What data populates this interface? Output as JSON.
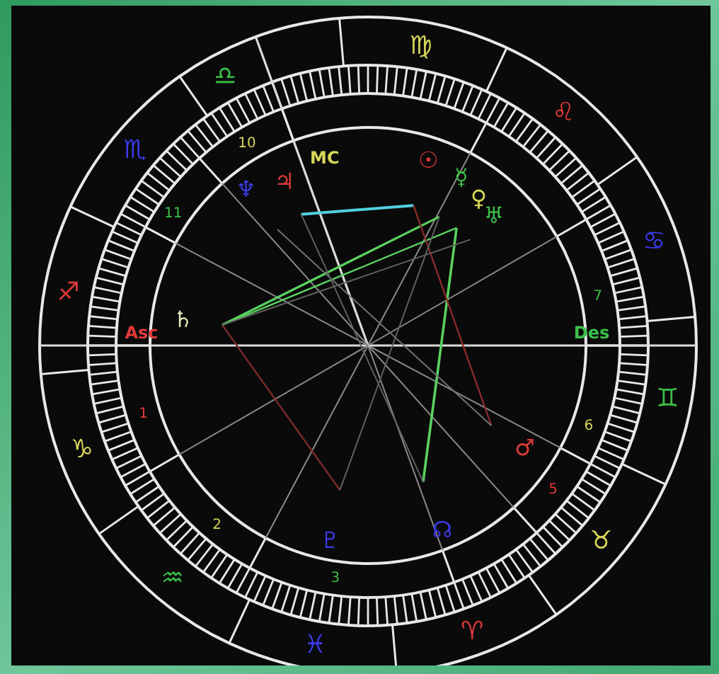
{
  "chart": {
    "signs": [
      {
        "glyph": "♎",
        "color": "#3cc048"
      },
      {
        "glyph": "♍",
        "color": "#d6d65a"
      },
      {
        "glyph": "♌",
        "color": "#e03a3a"
      },
      {
        "glyph": "♋",
        "color": "#3a3ae6"
      },
      {
        "glyph": "♊",
        "color": "#3cc048"
      },
      {
        "glyph": "♉",
        "color": "#d6d65a"
      },
      {
        "glyph": "♈",
        "color": "#e03a3a"
      },
      {
        "glyph": "♓",
        "color": "#3a3ae6"
      },
      {
        "glyph": "♒",
        "color": "#3cc048"
      },
      {
        "glyph": "♑",
        "color": "#d6d65a"
      },
      {
        "glyph": "♐",
        "color": "#e03a3a"
      },
      {
        "glyph": "♏",
        "color": "#3a3ae6"
      }
    ],
    "houses": [
      {
        "number": "1",
        "color": "#e03a3a"
      },
      {
        "number": "2",
        "color": "#d6d65a"
      },
      {
        "number": "3",
        "color": "#3cc048"
      },
      {
        "number": "5",
        "color": "#e03a3a"
      },
      {
        "number": "6",
        "color": "#d6d65a"
      },
      {
        "number": "7",
        "color": "#3cc048"
      },
      {
        "number": "10",
        "color": "#d6d65a"
      },
      {
        "number": "11",
        "color": "#3cc048"
      }
    ],
    "angles": [
      {
        "label": "Asc",
        "color": "#e03a3a"
      },
      {
        "label": "Des",
        "color": "#3cc048"
      },
      {
        "label": "MC",
        "color": "#d6d65a"
      }
    ],
    "planets": [
      {
        "glyph": "♃",
        "color": "#e03a3a"
      },
      {
        "glyph": "♆",
        "color": "#3a3ae6"
      },
      {
        "glyph": "☉",
        "color": "#e03a3a"
      },
      {
        "glyph": "☿",
        "color": "#3cc048"
      },
      {
        "glyph": "♀",
        "color": "#d6d65a"
      },
      {
        "glyph": "♅",
        "color": "#3cc048"
      },
      {
        "glyph": "♄",
        "color": "#e8e8c0"
      },
      {
        "glyph": "♂",
        "color": "#e03a3a"
      },
      {
        "glyph": "♇",
        "color": "#3a3ae6"
      },
      {
        "glyph": "☊",
        "color": "#3a3ae6"
      }
    ]
  }
}
